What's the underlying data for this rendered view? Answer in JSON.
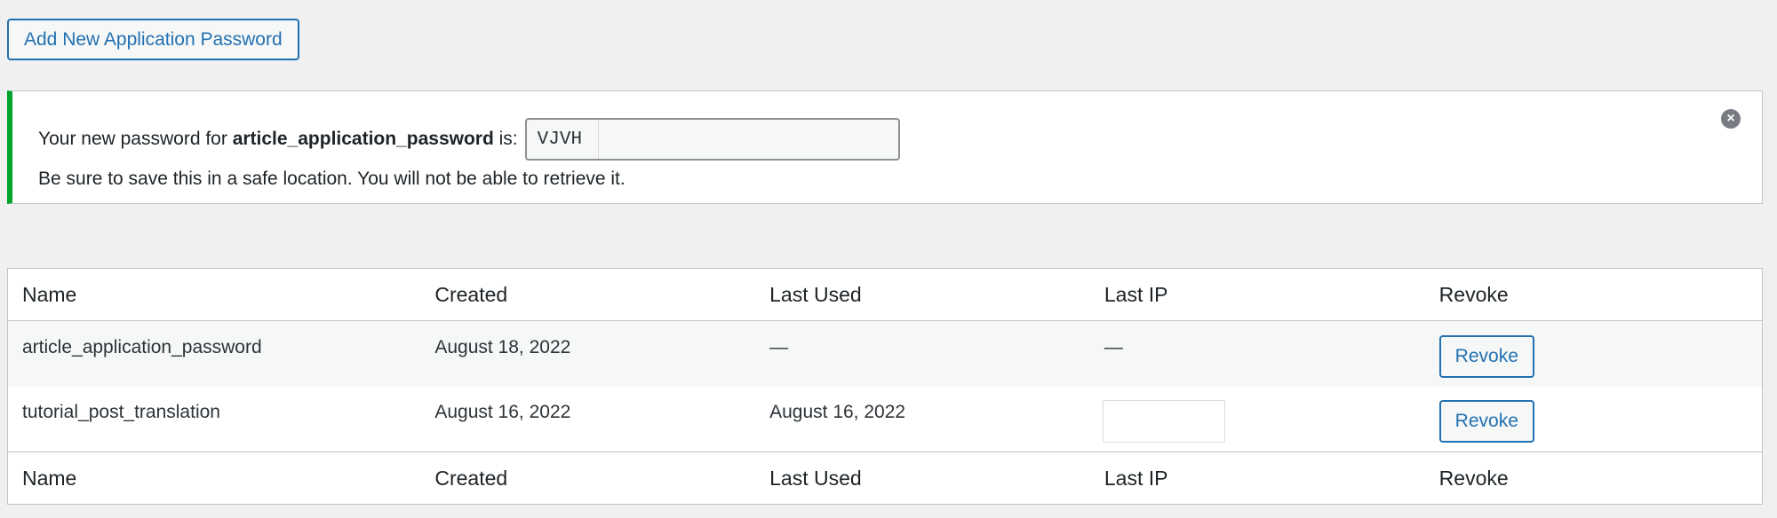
{
  "toolbar": {
    "add_button_label": "Add New Application Password"
  },
  "notice": {
    "prefix": "Your new password for",
    "app_name": "article_application_password",
    "suffix": "is:",
    "password_value": "VJVH",
    "warning": "Be sure to save this in a safe location. You will not be able to retrieve it.",
    "dismiss_icon": "dismiss-icon",
    "accent_color": "#00a32a"
  },
  "table": {
    "columns": [
      "Name",
      "Created",
      "Last Used",
      "Last IP",
      "Revoke"
    ],
    "rows": [
      {
        "name": "article_application_password",
        "created": "August 18, 2022",
        "last_used": "—",
        "last_ip": "—",
        "revoke_label": "Revoke"
      },
      {
        "name": "tutorial_post_translation",
        "created": "August 16, 2022",
        "last_used": "August 16, 2022",
        "last_ip": "",
        "revoke_label": "Revoke"
      }
    ]
  },
  "colors": {
    "accent": "#2271b1",
    "background": "#f0f0f1",
    "notice_border": "#00a32a"
  }
}
